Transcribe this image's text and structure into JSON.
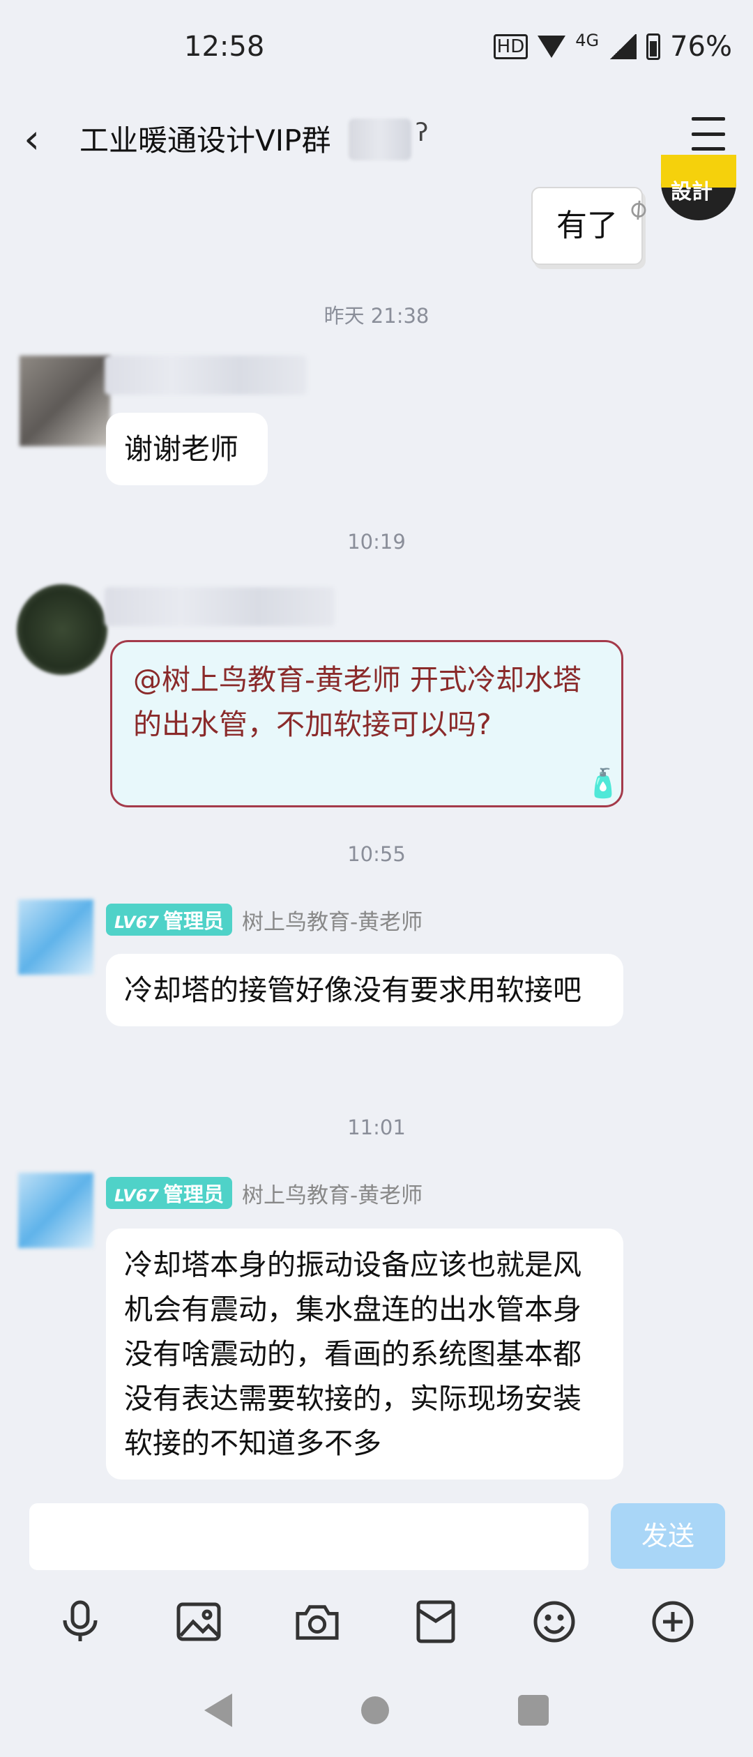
{
  "status": {
    "time": "12:58",
    "network": "4G",
    "battery": "76%"
  },
  "header": {
    "title": "工业暖通设计VIP群"
  },
  "messages": {
    "m0_text": "有了",
    "m0_sticker_text": "設計",
    "ts1": "昨天 21:38",
    "m1_text": "谢谢老师",
    "ts2": "10:19",
    "m2_text": "@树上鸟教育-黄老师  开式冷却水塔的出水管，不加软接可以吗?",
    "ts3": "10:55",
    "m3_badge_level": "LV67",
    "m3_badge_role": "管理员",
    "m3_name": "树上鸟教育-黄老师",
    "m3_text": "冷却塔的接管好像没有要求用软接吧",
    "ts4": "11:01",
    "m4_badge_level": "LV67",
    "m4_badge_role": "管理员",
    "m4_name": "树上鸟教育-黄老师",
    "m4_text": "冷却塔本身的振动设备应该也就是风机会有震动，集水盘连的出水管本身没有啥震动的，看画的系统图基本都没有表达需要软接的，实际现场安装软接的不知道多不多"
  },
  "input": {
    "placeholder": "",
    "send_label": "发送"
  },
  "colors": {
    "accent": "#a9d6f7",
    "badge": "#4fd2c8",
    "special_text": "#8a2a2a"
  }
}
